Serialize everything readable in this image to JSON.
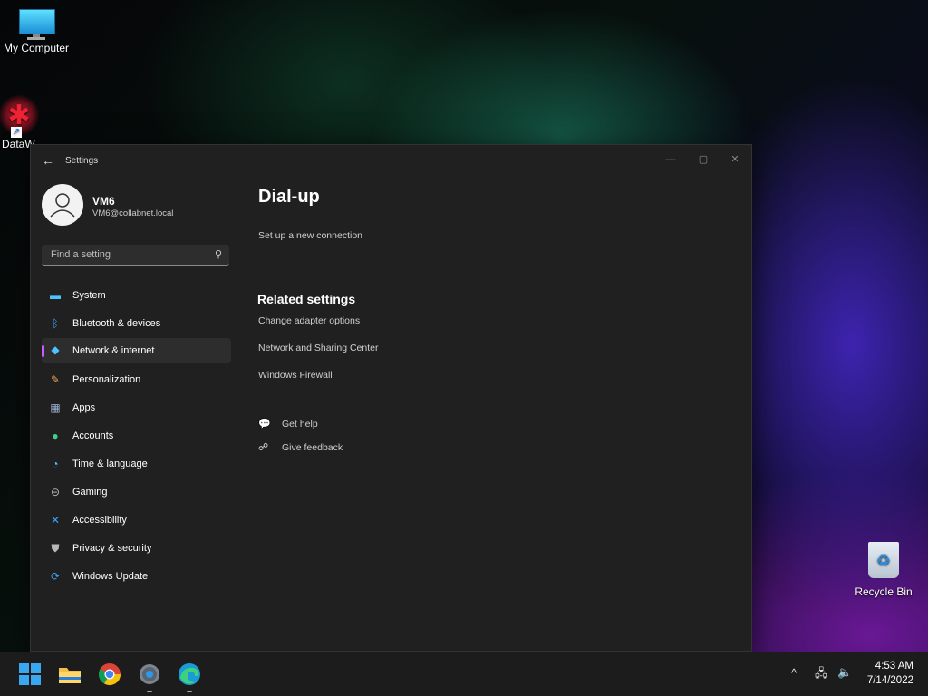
{
  "desktop": {
    "icons": [
      {
        "label": "My Computer",
        "icon": "monitor-icon"
      },
      {
        "label": "DataW",
        "icon": "datawrapper-icon"
      },
      {
        "label": "Recycle Bin",
        "icon": "recycle-bin-icon"
      }
    ]
  },
  "window": {
    "title": "Settings",
    "controls": {
      "minimize": "—",
      "maximize": "▢",
      "close": "✕"
    }
  },
  "profile": {
    "name": "VM6",
    "email": "VM6@collabnet.local"
  },
  "search": {
    "placeholder": "Find a setting"
  },
  "nav": {
    "items": [
      {
        "label": "System",
        "icon": "system-icon",
        "color": "#4cc2ff",
        "selected": false
      },
      {
        "label": "Bluetooth & devices",
        "icon": "bluetooth-icon",
        "color": "#3aa0f5",
        "selected": false
      },
      {
        "label": "Network & internet",
        "icon": "wifi-icon",
        "color": "#4cc2ff",
        "selected": true
      },
      {
        "label": "Personalization",
        "icon": "brush-icon",
        "color": "#f3a05a",
        "selected": false
      },
      {
        "label": "Apps",
        "icon": "apps-icon",
        "color": "#9fb6d8",
        "selected": false
      },
      {
        "label": "Accounts",
        "icon": "person-icon",
        "color": "#3ecf8e",
        "selected": false
      },
      {
        "label": "Time & language",
        "icon": "globe-clock-icon",
        "color": "#4cc2ff",
        "selected": false
      },
      {
        "label": "Gaming",
        "icon": "gamepad-icon",
        "color": "#b8b8b8",
        "selected": false
      },
      {
        "label": "Accessibility",
        "icon": "accessibility-icon",
        "color": "#3aa0f5",
        "selected": false
      },
      {
        "label": "Privacy & security",
        "icon": "shield-icon",
        "color": "#b8b8b8",
        "selected": false
      },
      {
        "label": "Windows Update",
        "icon": "update-icon",
        "color": "#3aa0f5",
        "selected": false
      }
    ]
  },
  "main": {
    "title": "Dial-up",
    "setup_link": "Set up a new connection",
    "related_title": "Related settings",
    "related_links": [
      "Change adapter options",
      "Network and Sharing Center",
      "Windows Firewall"
    ],
    "help": {
      "get_help": "Get help",
      "give_feedback": "Give feedback"
    }
  },
  "taskbar": {
    "apps": [
      "start-icon",
      "file-explorer-icon",
      "chrome-icon",
      "settings-icon",
      "edge-icon"
    ],
    "tray": {
      "chevron": "^",
      "network": "network-icon",
      "volume": "volume-icon"
    },
    "time": "4:53 AM",
    "date": "7/14/2022"
  },
  "colors": {
    "accent": "#c95bff",
    "window_bg": "#202020",
    "taskbar_bg": "#1c1c1c"
  }
}
